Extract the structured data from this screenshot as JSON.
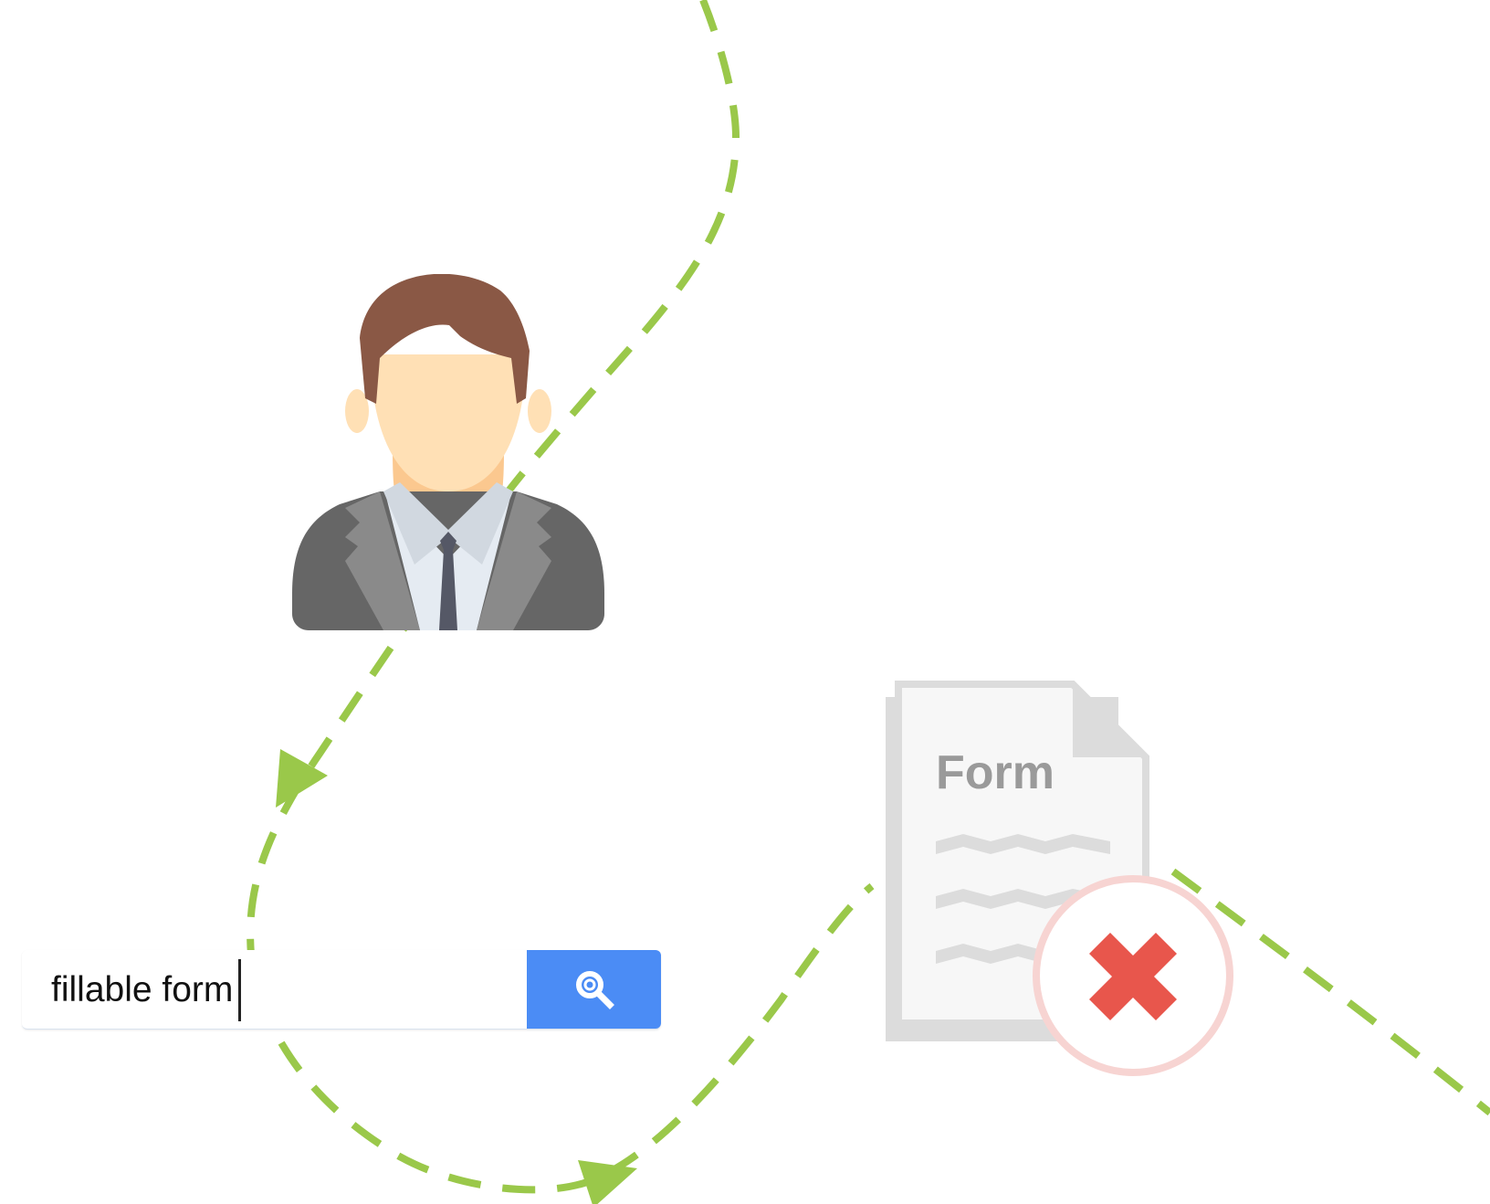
{
  "search": {
    "value": "fillable form",
    "button_icon": "search-icon"
  },
  "document": {
    "title": "Form",
    "icon": "document-icon",
    "status_icon": "reject-x-icon"
  },
  "colors": {
    "path": "#9ac84a",
    "button": "#4b8cf5",
    "reject_x": "#e8564c",
    "reject_ring": "#f7d4d2",
    "document_fill": "#f7f7f7",
    "document_border": "#dcdcdc",
    "person_hair": "#8a5845",
    "person_skin": "#ffe0b5",
    "suit": "#666666"
  },
  "icons": {
    "person": "person-icon",
    "direction_arrow": "arrowhead-icon"
  }
}
